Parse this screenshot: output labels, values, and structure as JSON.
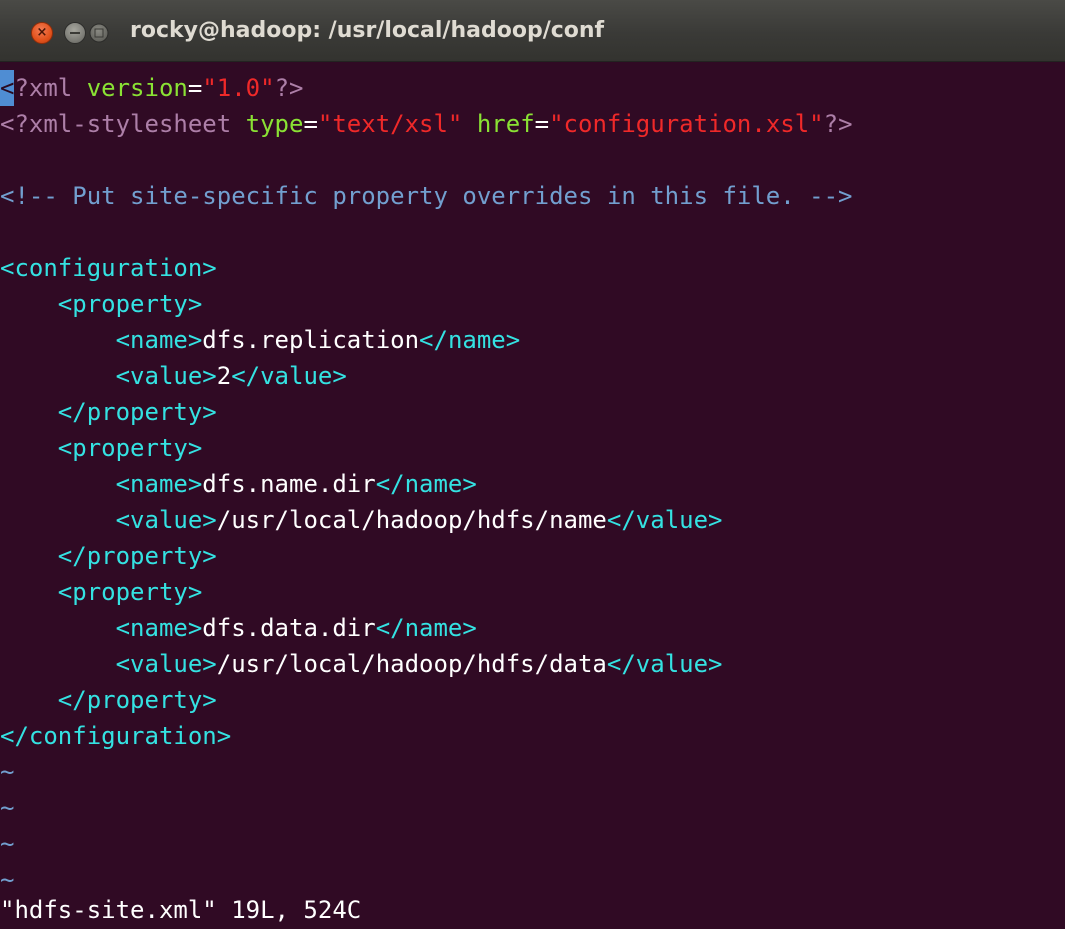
{
  "window": {
    "title": "rocky@hadoop: /usr/local/hadoop/conf",
    "close_glyph": "×"
  },
  "colors": {
    "background": "#300a24",
    "titlebar": "#3c3b37",
    "tag": "#34e2e2",
    "text": "#ffffff",
    "string": "#ef2929",
    "attribute": "#8ae234",
    "comment": "#729fcf",
    "xml_decl": "#ad7fa8",
    "tilde": "#729fcf",
    "cursor": "#4f8dd3"
  },
  "editor": {
    "lines": [
      [
        {
          "t": "<",
          "c": "cursor"
        },
        {
          "t": "?xml ",
          "c": "decl"
        },
        {
          "t": "version",
          "c": "attr"
        },
        {
          "t": "=",
          "c": "text"
        },
        {
          "t": "\"1.0\"",
          "c": "string"
        },
        {
          "t": "?>",
          "c": "decl"
        }
      ],
      [
        {
          "t": "<?xml-stylesheet ",
          "c": "decl"
        },
        {
          "t": "type",
          "c": "attr"
        },
        {
          "t": "=",
          "c": "text"
        },
        {
          "t": "\"text/xsl\"",
          "c": "string"
        },
        {
          "t": " ",
          "c": "text"
        },
        {
          "t": "href",
          "c": "attr"
        },
        {
          "t": "=",
          "c": "text"
        },
        {
          "t": "\"configuration.xsl\"",
          "c": "string"
        },
        {
          "t": "?>",
          "c": "decl"
        }
      ],
      [],
      [
        {
          "t": "<!-- Put site-specific property overrides in this file. -->",
          "c": "comment"
        }
      ],
      [],
      [
        {
          "t": "<configuration>",
          "c": "tag"
        }
      ],
      [
        {
          "t": "    <property>",
          "c": "tag"
        }
      ],
      [
        {
          "t": "        <name>",
          "c": "tag"
        },
        {
          "t": "dfs.replication",
          "c": "text"
        },
        {
          "t": "</name>",
          "c": "tag"
        }
      ],
      [
        {
          "t": "        <value>",
          "c": "tag"
        },
        {
          "t": "2",
          "c": "text"
        },
        {
          "t": "</value>",
          "c": "tag"
        }
      ],
      [
        {
          "t": "    </property>",
          "c": "tag"
        }
      ],
      [
        {
          "t": "    <property>",
          "c": "tag"
        }
      ],
      [
        {
          "t": "        <name>",
          "c": "tag"
        },
        {
          "t": "dfs.name.dir",
          "c": "text"
        },
        {
          "t": "</name>",
          "c": "tag"
        }
      ],
      [
        {
          "t": "        <value>",
          "c": "tag"
        },
        {
          "t": "/usr/local/hadoop/hdfs/name",
          "c": "text"
        },
        {
          "t": "</value>",
          "c": "tag"
        }
      ],
      [
        {
          "t": "    </property>",
          "c": "tag"
        }
      ],
      [
        {
          "t": "    <property>",
          "c": "tag"
        }
      ],
      [
        {
          "t": "        <name>",
          "c": "tag"
        },
        {
          "t": "dfs.data.dir",
          "c": "text"
        },
        {
          "t": "</name>",
          "c": "tag"
        }
      ],
      [
        {
          "t": "        <value>",
          "c": "tag"
        },
        {
          "t": "/usr/local/hadoop/hdfs/data",
          "c": "text"
        },
        {
          "t": "</value>",
          "c": "tag"
        }
      ],
      [
        {
          "t": "    </property>",
          "c": "tag"
        }
      ],
      [
        {
          "t": "</configuration>",
          "c": "tag"
        }
      ],
      [
        {
          "t": "~",
          "c": "tilde"
        }
      ],
      [
        {
          "t": "~",
          "c": "tilde"
        }
      ],
      [
        {
          "t": "~",
          "c": "tilde"
        }
      ],
      [
        {
          "t": "~",
          "c": "tilde"
        }
      ]
    ]
  },
  "status_line": "\"hdfs-site.xml\" 19L, 524C"
}
